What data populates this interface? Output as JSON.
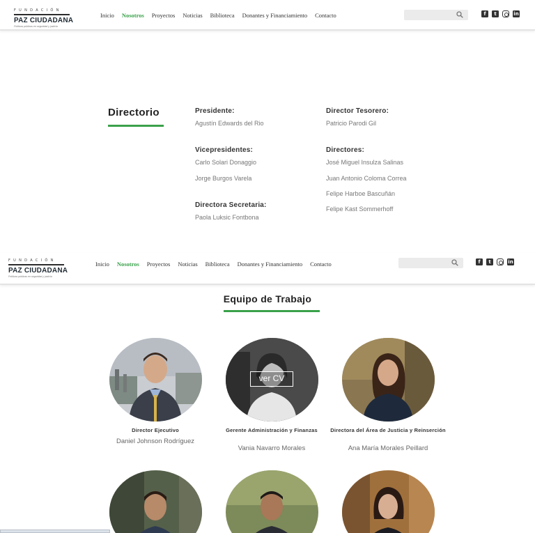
{
  "brand": {
    "top": "FUNDACIÓN",
    "name": "PAZ CIUDADANA",
    "tagline": "Políticas públicas en seguridad y justicia"
  },
  "nav": {
    "items": [
      "Inicio",
      "Nosotros",
      "Proyectos",
      "Noticias",
      "Biblioteca",
      "Donantes y Financiamiento",
      "Contacto"
    ],
    "active": "Nosotros"
  },
  "search": {
    "placeholder": ""
  },
  "social": [
    "facebook-icon",
    "twitter-icon",
    "instagram-icon",
    "linkedin-icon"
  ],
  "directorio": {
    "title": "Directorio",
    "presidente_label": "Presidente:",
    "presidente": "Agustín Edwards del Rio",
    "tesorero_label": "Director Tesorero:",
    "tesorero": "Patricio Parodi Gil",
    "vice_label": "Vicepresidentes:",
    "vice": [
      "Carlo Solari Donaggio",
      "Jorge Burgos Varela"
    ],
    "directores_label": "Directores:",
    "directores": [
      "José Miguel Insulza Salinas",
      "Juan Antonio Coloma Correa",
      "Felipe Harboe Bascuñán",
      "Felipe Kast Sommerhoff"
    ],
    "secretaria_label": "Directora Secretaria:",
    "secretaria": "Paola Luksic Fontbona"
  },
  "equipo": {
    "title": "Equipo de Trabajo",
    "ver_cv": "ver CV",
    "members": [
      {
        "title": "Director Ejecutivo",
        "name": "Daniel Johnson Rodríguez"
      },
      {
        "title": "Gerente Administración y Finanzas",
        "name": "Vania Navarro Morales"
      },
      {
        "title": "Directora del Área de Justicia y Reinserción",
        "name": "Ana María Morales Peillard"
      }
    ]
  },
  "colors": {
    "accent": "#3aa14a",
    "text": "#333333",
    "muted": "#777777"
  }
}
